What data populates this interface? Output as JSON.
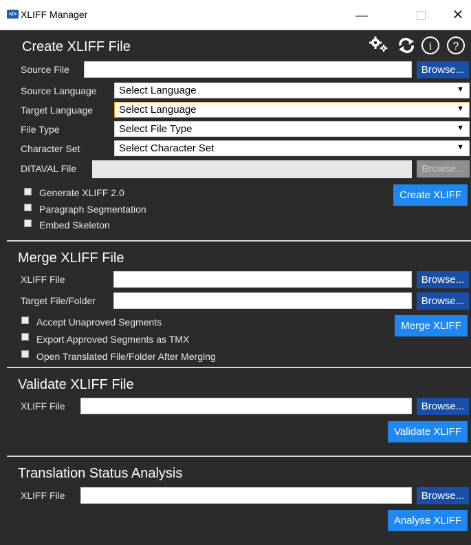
{
  "window": {
    "title": "XLIFF Manager",
    "icon_text": "</>",
    "minimize": "—",
    "close": "✕"
  },
  "toolbar": {
    "icons": [
      "settings-icon",
      "refresh-icon",
      "info-icon",
      "help-icon"
    ],
    "info_glyph": "i",
    "help_glyph": "?"
  },
  "create": {
    "title": "Create XLIFF File",
    "source_file_label": "Source File",
    "source_file_value": "",
    "browse_label": "Browse...",
    "source_language_label": "Source Language",
    "source_language_value": "Select Language",
    "target_language_label": "Target Language",
    "target_language_value": "Select Language",
    "file_type_label": "File Type",
    "file_type_value": "Select File Type",
    "charset_label": "Character Set",
    "charset_value": "Select Character Set",
    "ditaval_label": "DITAVAL File",
    "ditaval_value": "",
    "ditaval_browse_label": "Browse...",
    "options": [
      "Generate XLIFF 2.0",
      "Paragraph Segmentation",
      "Embed Skeleton"
    ],
    "action_label": "Create XLIFF"
  },
  "merge": {
    "title": "Merge XLIFF File",
    "xliff_label": "XLIFF File",
    "xliff_value": "",
    "target_label": "Target File/Folder",
    "target_value": "",
    "browse_label": "Browse...",
    "options": [
      "Accept Unaproved Segments",
      "Export Approved Segments as TMX",
      "Open Translated File/Folder After Merging"
    ],
    "action_label": "Merge XLIFF"
  },
  "validate": {
    "title": "Validate XLIFF File",
    "xliff_label": "XLIFF File",
    "xliff_value": "",
    "browse_label": "Browse...",
    "action_label": "Validate XLIFF"
  },
  "analysis": {
    "title": "Translation Status Analysis",
    "xliff_label": "XLIFF File",
    "xliff_value": "",
    "browse_label": "Browse...",
    "action_label": "Analyse XLIFF"
  },
  "colors": {
    "background": "#2b2b2b",
    "browse_button": "#1a4fa8",
    "action_button": "#1e87f0",
    "focus_border": "#e8a400"
  }
}
